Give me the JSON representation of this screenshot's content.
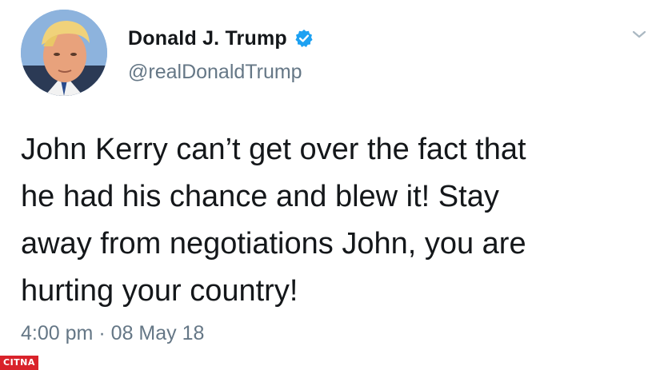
{
  "tweet": {
    "author": {
      "display_name": "Donald J. Trump",
      "handle": "@realDonaldTrump",
      "verified": true,
      "avatar_icon": "profile-photo"
    },
    "text": "John Kerry can’t get over the fact that\nhe had his chance and blew it! Stay\naway from negotiations John, you are\nhurting your country!",
    "time": "4:00 pm",
    "separator": "·",
    "date": "08 May 18",
    "menu_icon": "chevron-down-icon"
  },
  "watermark": {
    "text": "CITNA",
    "color": "#d9222a"
  },
  "colors": {
    "text_primary": "#14171a",
    "text_secondary": "#657786",
    "verified_blue": "#1da1f2",
    "caret": "#aab8c2"
  }
}
